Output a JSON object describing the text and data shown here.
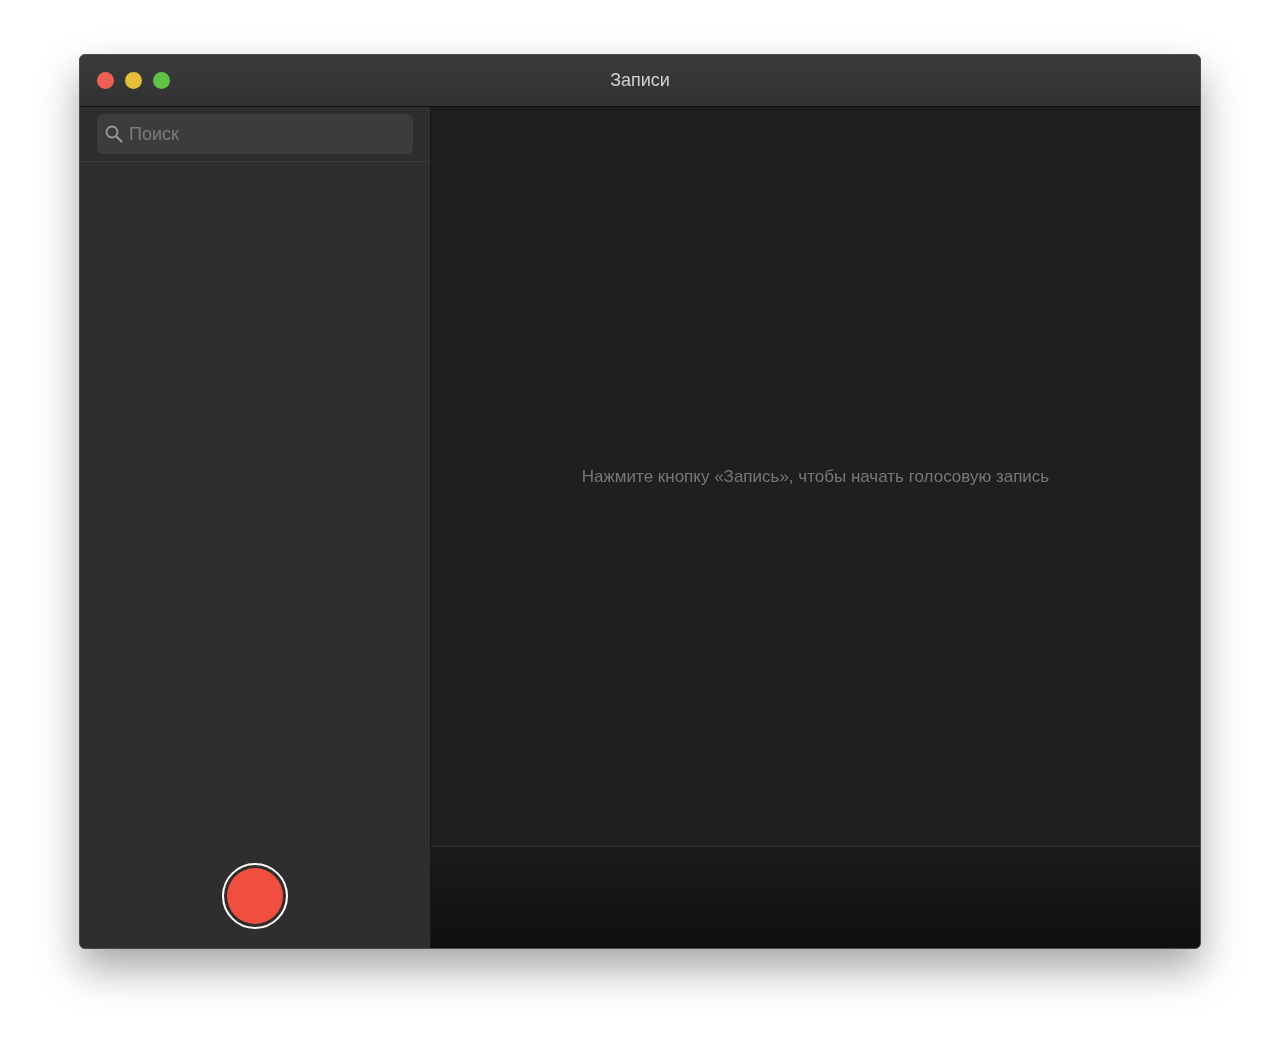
{
  "window": {
    "title": "Записи"
  },
  "sidebar": {
    "search": {
      "placeholder": "Поиск"
    }
  },
  "main": {
    "empty_message": "Нажмите кнопку «Запись», чтобы начать голосовую запись"
  }
}
